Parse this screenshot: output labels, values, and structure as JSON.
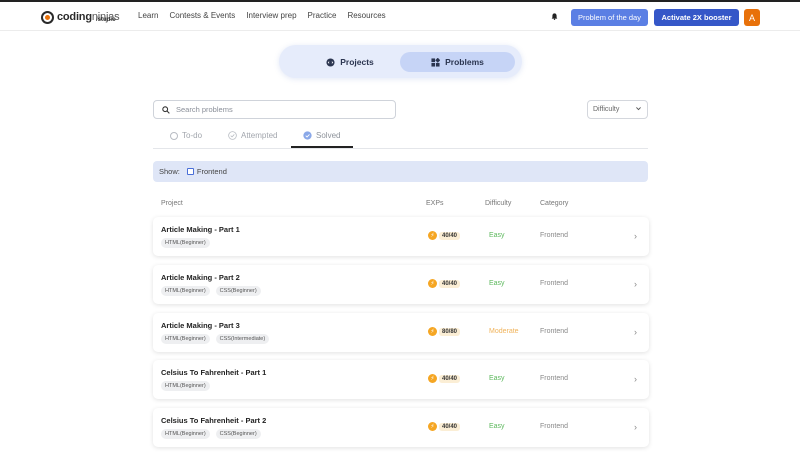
{
  "header": {
    "logo_main": "coding",
    "logo_light": "ninjas",
    "logo_sub": "/studio",
    "nav": [
      "Learn",
      "Contests & Events",
      "Interview prep",
      "Practice",
      "Resources"
    ],
    "problem_of_day": "Problem of the day",
    "activate": "Activate 2X booster",
    "avatar_letter": "A"
  },
  "switcher": {
    "projects": "Projects",
    "problems": "Problems",
    "active": "Problems"
  },
  "search": {
    "placeholder": "Search problems",
    "value": ""
  },
  "difficulty_select": "Difficulty",
  "tabs": [
    {
      "label": "To-do",
      "active": false
    },
    {
      "label": "Attempted",
      "active": false
    },
    {
      "label": "Solved",
      "active": true
    }
  ],
  "show": {
    "label": "Show:",
    "filter": "Frontend",
    "checked": false
  },
  "columns": {
    "project": "Project",
    "exps": "EXPs",
    "difficulty": "Difficulty",
    "category": "Category"
  },
  "rows": [
    {
      "title": "Article Making - Part 1",
      "tags": [
        "HTML(Beginner)"
      ],
      "exp": "40/40",
      "difficulty": "Easy",
      "category": "Frontend"
    },
    {
      "title": "Article Making - Part 2",
      "tags": [
        "HTML(Beginner)",
        "CSS(Beginner)"
      ],
      "exp": "40/40",
      "difficulty": "Easy",
      "category": "Frontend"
    },
    {
      "title": "Article Making - Part 3",
      "tags": [
        "HTML(Beginner)",
        "CSS(Intermediate)"
      ],
      "exp": "80/80",
      "difficulty": "Moderate",
      "category": "Frontend"
    },
    {
      "title": "Celsius To Fahrenheit - Part 1",
      "tags": [
        "HTML(Beginner)"
      ],
      "exp": "40/40",
      "difficulty": "Easy",
      "category": "Frontend"
    },
    {
      "title": "Celsius To Fahrenheit - Part 2",
      "tags": [
        "HTML(Beginner)",
        "CSS(Beginner)"
      ],
      "exp": "40/40",
      "difficulty": "Easy",
      "category": "Frontend"
    }
  ],
  "colors": {
    "easy": "#5cb85c",
    "moderate": "#f0b35a",
    "brand_orange": "#e8710a",
    "primary_blue": "#3557c8"
  },
  "icons": {
    "search": "search-icon",
    "bell": "bell-icon",
    "chevron": "chevron-right-icon",
    "coin": "coin-icon"
  }
}
